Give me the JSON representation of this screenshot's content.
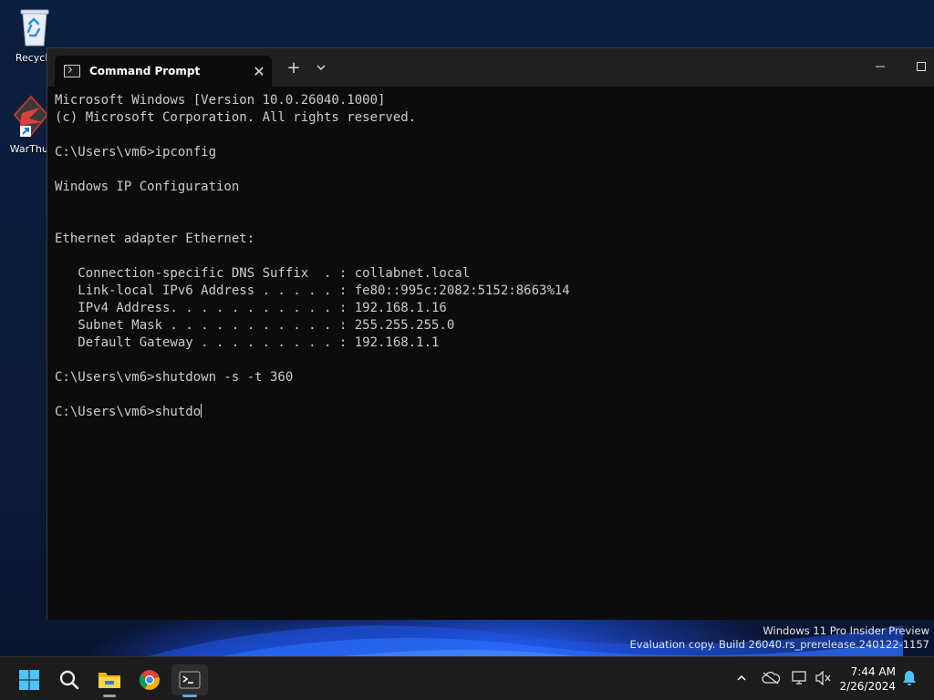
{
  "desktop": {
    "icons": [
      {
        "label": "Recycle",
        "icon": "recycle-bin-icon"
      },
      {
        "label": "WarThur",
        "icon": "warthunder-shortcut-icon"
      }
    ]
  },
  "window": {
    "tab_title": "Command Prompt",
    "tab_icon": "cmd-icon",
    "new_tab_label": "+",
    "dropdown_icon": "chevron-down-icon",
    "minimize_icon": "minimize-icon",
    "maximize_icon": "maximize-icon"
  },
  "console": {
    "lines": [
      "Microsoft Windows [Version 10.0.26040.1000]",
      "(c) Microsoft Corporation. All rights reserved.",
      "",
      "C:\\Users\\vm6>ipconfig",
      "",
      "Windows IP Configuration",
      "",
      "",
      "Ethernet adapter Ethernet:",
      "",
      "   Connection-specific DNS Suffix  . : collabnet.local",
      "   Link-local IPv6 Address . . . . . : fe80::995c:2082:5152:8663%14",
      "   IPv4 Address. . . . . . . . . . . : 192.168.1.16",
      "   Subnet Mask . . . . . . . . . . . : 255.255.255.0",
      "   Default Gateway . . . . . . . . . : 192.168.1.1",
      "",
      "C:\\Users\\vm6>shutdown -s -t 360",
      "",
      "C:\\Users\\vm6>shutdo"
    ]
  },
  "watermark": {
    "line1": "Windows 11 Pro Insider Preview",
    "line2": "Evaluation copy. Build 26040.rs_prerelease.240122-1157"
  },
  "taskbar": {
    "items": [
      "start-icon",
      "search-icon",
      "file-explorer-icon",
      "chrome-icon",
      "terminal-icon"
    ],
    "tray": [
      "chevron-up-icon",
      "cloud-offline-icon",
      "network-icon",
      "volume-muted-icon",
      "notification-bell-icon"
    ],
    "time": "7:44 AM",
    "date": "2/26/2024"
  },
  "colors": {
    "console_bg": "#0c0c0c",
    "console_fg": "#cccccc",
    "titlebar_bg": "#202020",
    "taskbar_bg": "#1c1c1c",
    "accent": "#5aa9f0"
  }
}
